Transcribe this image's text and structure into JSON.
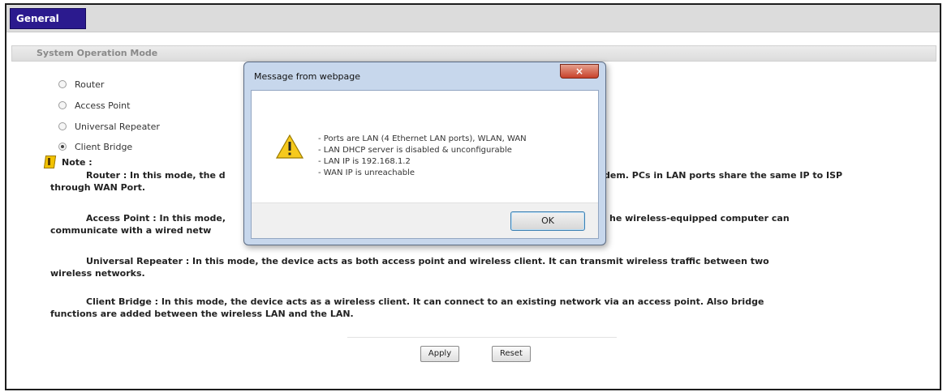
{
  "tabs": [
    {
      "label": "General"
    }
  ],
  "section": {
    "title": "System Operation Mode"
  },
  "modes": [
    {
      "label": "Router",
      "checked": false
    },
    {
      "label": "Access Point",
      "checked": false
    },
    {
      "label": "Universal Repeater",
      "checked": false
    },
    {
      "label": "Client Bridge",
      "checked": true
    }
  ],
  "note": {
    "title": "Note :",
    "paragraphs": [
      {
        "line1": "Router : In this mode, the d",
        "line1_right": "dem. PCs in LAN ports share the same IP to ISP",
        "line2": "through WAN Port."
      },
      {
        "line1": "Access Point : In this mode,",
        "line1_right": "he wireless-equipped computer can",
        "line2": "communicate with a wired netw"
      },
      {
        "line1": "Universal Repeater : In this mode, the device acts as both access point and wireless client. It can transmit wireless traffic between two",
        "line1_right": "",
        "line2": "wireless networks."
      },
      {
        "line1": "Client Bridge : In this mode, the device acts as a wireless client. It can connect to an existing network via an access point. Also bridge",
        "line1_right": "",
        "line2": "functions are added between the wireless LAN and the LAN."
      }
    ]
  },
  "buttons": {
    "apply": "Apply",
    "reset": "Reset"
  },
  "dialog": {
    "title": "Message from webpage",
    "close": "×",
    "icon": "warning-icon",
    "lines": [
      "- Ports are LAN (4 Ethernet LAN ports), WLAN, WAN",
      "- LAN DHCP server is disabled & unconfigurable",
      "- LAN IP is 192.168.1.2",
      "- WAN IP is unreachable"
    ],
    "ok": "OK"
  }
}
